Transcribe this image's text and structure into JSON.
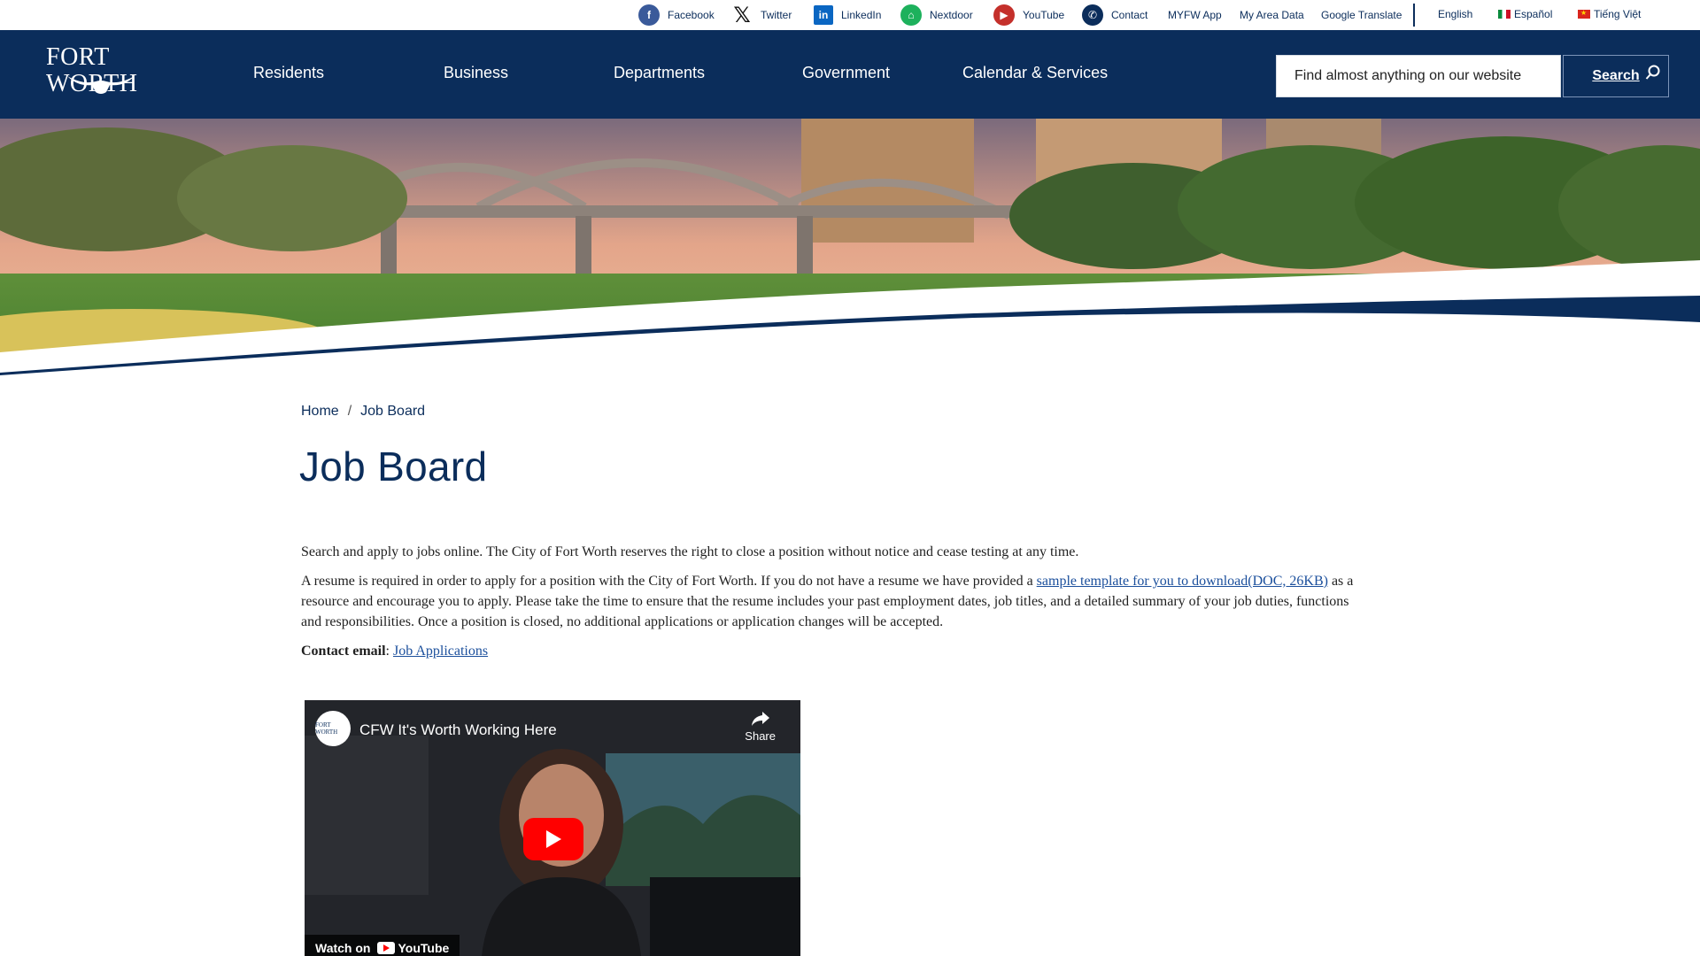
{
  "topbar": {
    "social": [
      {
        "label": "Facebook",
        "icon": "facebook-icon",
        "glyph": "f"
      },
      {
        "label": "Twitter",
        "icon": "x-twitter-icon",
        "glyph": "𝕏"
      },
      {
        "label": "LinkedIn",
        "icon": "linkedin-icon",
        "glyph": "in"
      },
      {
        "label": "Nextdoor",
        "icon": "nextdoor-icon",
        "glyph": "⌂"
      },
      {
        "label": "YouTube",
        "icon": "youtube-icon",
        "glyph": "▶"
      },
      {
        "label": "Contact",
        "icon": "phone-icon",
        "glyph": "✆"
      }
    ],
    "links": [
      "MYFW App",
      "My Area Data",
      "Google Translate"
    ],
    "languages": [
      "English",
      "Español",
      "Tiếng Việt"
    ]
  },
  "nav": {
    "logo_text": "FORT WORTH",
    "items": [
      "Residents",
      "Business",
      "Departments",
      "Government",
      "Calendar & Services"
    ],
    "search_placeholder": "Find almost anything on our website",
    "search_button": "Search"
  },
  "breadcrumb": {
    "home": "Home",
    "separator": "/",
    "current": "Job Board"
  },
  "page": {
    "title": "Job Board",
    "intro": "Search and apply to jobs online. The City of Fort Worth reserves the right to close a position without notice and cease testing at any time.",
    "resume_text_1": "A resume is required in order to apply for a position with the City of Fort Worth. If you do not have a resume we have provided a ",
    "resume_link": "sample template for you to download(DOC, 26KB)",
    "resume_text_2": " as a resource and encourage you to apply. Please take the time to ensure that the resume includes your past employment dates, job titles, and a detailed summary of your job duties, functions and responsibilities. Once a position is closed, no additional applications or application changes will be accepted.",
    "contact_label": "Contact email",
    "contact_link": "Job Applications"
  },
  "video": {
    "title": "CFW It's Worth Working Here",
    "share": "Share",
    "watch_on": "Watch on",
    "youtube": "YouTube",
    "channel_logo": "FORT WORTH"
  },
  "colors": {
    "navy": "#0b2d5b",
    "link": "#1b4f9c",
    "youtube_red": "#ff0000"
  }
}
